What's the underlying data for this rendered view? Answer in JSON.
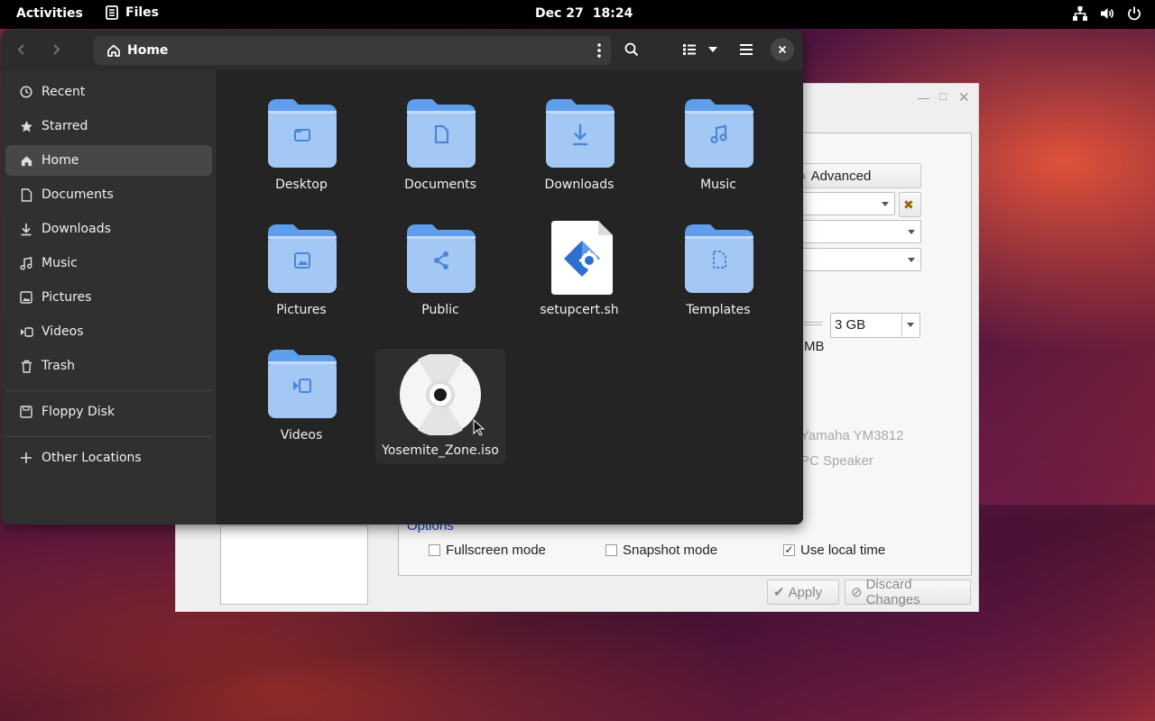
{
  "topbar": {
    "activities": "Activities",
    "app_name": "Files",
    "date": "Dec 27",
    "time": "18:24",
    "tray_icons": [
      "network-icon",
      "volume-icon",
      "power-icon"
    ]
  },
  "files_window": {
    "path_label": "Home",
    "sidebar": {
      "items": [
        {
          "label": "Recent",
          "icon": "clock-icon"
        },
        {
          "label": "Starred",
          "icon": "star-icon"
        },
        {
          "label": "Home",
          "icon": "home-icon",
          "active": true
        },
        {
          "label": "Documents",
          "icon": "document-icon"
        },
        {
          "label": "Downloads",
          "icon": "download-icon"
        },
        {
          "label": "Music",
          "icon": "music-icon"
        },
        {
          "label": "Pictures",
          "icon": "picture-icon"
        },
        {
          "label": "Videos",
          "icon": "video-icon"
        },
        {
          "label": "Trash",
          "icon": "trash-icon"
        }
      ],
      "devices": [
        {
          "label": "Floppy Disk",
          "icon": "drive-icon"
        }
      ],
      "other": {
        "label": "Other Locations",
        "icon": "plus-icon"
      }
    },
    "grid": [
      {
        "name": "Desktop",
        "type": "folder",
        "glyph": "desktop"
      },
      {
        "name": "Documents",
        "type": "folder",
        "glyph": "document"
      },
      {
        "name": "Downloads",
        "type": "folder",
        "glyph": "download"
      },
      {
        "name": "Music",
        "type": "folder",
        "glyph": "music"
      },
      {
        "name": "Pictures",
        "type": "folder",
        "glyph": "picture"
      },
      {
        "name": "Public",
        "type": "folder",
        "glyph": "share"
      },
      {
        "name": "setupcert.sh",
        "type": "script"
      },
      {
        "name": "Templates",
        "type": "folder",
        "glyph": "template"
      },
      {
        "name": "Videos",
        "type": "folder",
        "glyph": "video"
      },
      {
        "name": "Yosemite_Zone.iso",
        "type": "disc",
        "hovered": true
      }
    ]
  },
  "background_dialog": {
    "advanced_button": "Advanced",
    "memory_value": "3 GB",
    "mb_label": "MB",
    "sound_1": "Yamaha YM3812",
    "sound_2": "PC Speaker",
    "options_label": "Options",
    "fullscreen_label": "Fullscreen mode",
    "snapshot_label": "Snapshot mode",
    "local_time_label": "Use local time",
    "local_time_checked": "✓",
    "apply_label": "Apply",
    "discard_label": "Discard Changes"
  },
  "colors": {
    "folder_light": "#a4c8f4",
    "folder_dark": "#5f9ded",
    "folder_glyph": "#4a86d8",
    "window_bg": "#242424",
    "sidebar_bg": "#303030"
  }
}
